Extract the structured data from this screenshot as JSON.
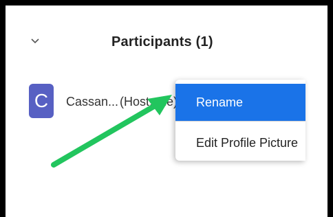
{
  "panel": {
    "title": "Participants (1)",
    "collapse_icon": "chevron-down-icon"
  },
  "participant": {
    "avatar_letter": "C",
    "avatar_color": "#5760c3",
    "name": "Cassan...",
    "role": "(Host, me)"
  },
  "context_menu": {
    "items": [
      {
        "label": "Rename",
        "highlighted": true
      },
      {
        "label": "Edit Profile Picture",
        "highlighted": false
      }
    ],
    "highlight_color": "#1a73e8"
  },
  "annotation": {
    "arrow_color": "#22c55e",
    "arrow_icon": "green-pointer-arrow"
  }
}
